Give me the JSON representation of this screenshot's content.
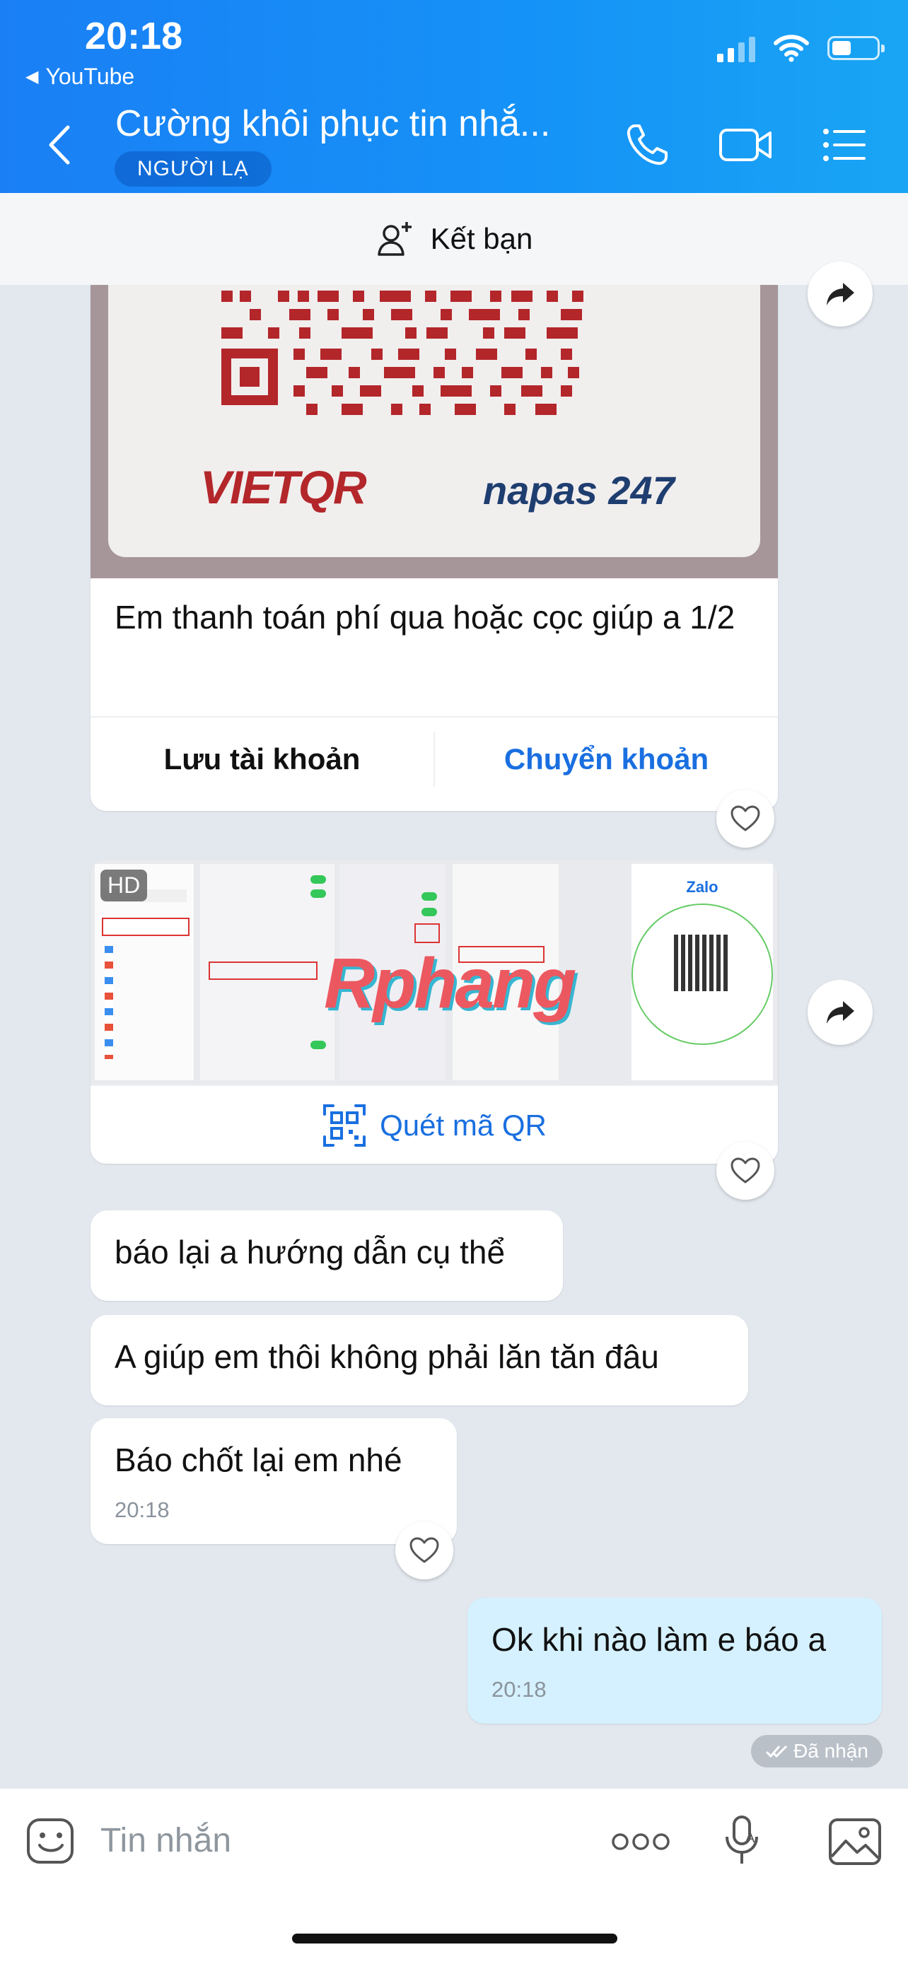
{
  "status_bar": {
    "time": "20:18",
    "back_app": "YouTube"
  },
  "header": {
    "title": "Cường khôi phục tin nhắ...",
    "badge": "NGƯỜI LẠ",
    "icons": [
      "phone-icon",
      "video-call-icon",
      "menu-list-icon"
    ]
  },
  "friend_bar": {
    "label": "Kết bạn",
    "icon": "add-friend-icon"
  },
  "messages": {
    "bank_card": {
      "logos": {
        "vietqr": "VIETQR",
        "napas": "napas 247"
      },
      "text": "Em thanh toán phí qua hoặc cọc giúp a 1/2",
      "save_label": "Lưu tài khoản",
      "transfer_label": "Chuyển khoản"
    },
    "image_card": {
      "hd_label": "HD",
      "watermark": "Rphang",
      "scan_label": "Quét mã QR",
      "zalo_label": "Zalo"
    },
    "m1": {
      "text": "báo lại a hướng dẫn cụ thể"
    },
    "m2": {
      "text": "A giúp em thôi không phải lăn tăn đâu"
    },
    "m3": {
      "text": "Báo chốt lại em nhé",
      "time": "20:18"
    },
    "mine": {
      "text": "Ok khi nào làm e báo a",
      "time": "20:18",
      "status": "Đã nhận"
    }
  },
  "composer": {
    "placeholder": "Tin nhắn"
  },
  "colors": {
    "header": "#1a7ff5",
    "link": "#1a6fe0",
    "mine_bubble": "#d5f1ff",
    "qr_red": "#b3262a"
  }
}
